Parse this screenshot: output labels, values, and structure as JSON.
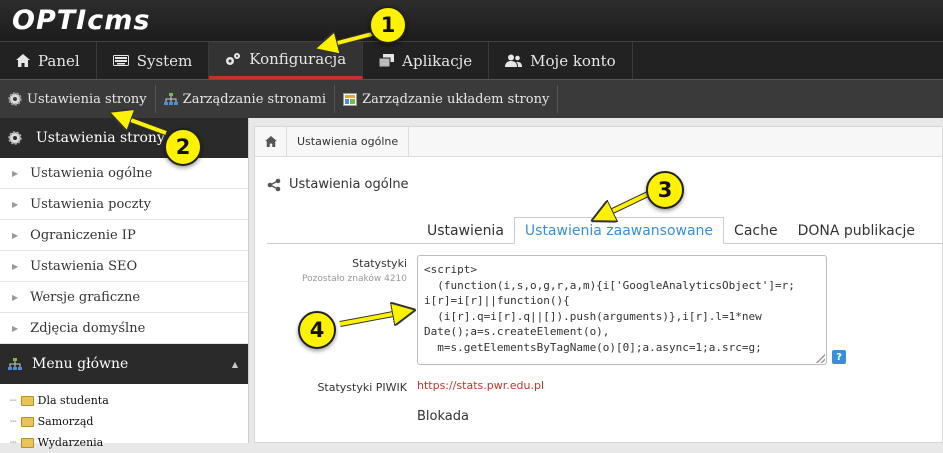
{
  "app": {
    "logo": "OPTIcms"
  },
  "mainnav": [
    {
      "label": "Panel",
      "icon": "home-icon"
    },
    {
      "label": "System",
      "icon": "keyboard-icon"
    },
    {
      "label": "Konfiguracja",
      "icon": "gears-icon"
    },
    {
      "label": "Aplikacje",
      "icon": "stack-icon"
    },
    {
      "label": "Moje konto",
      "icon": "users-icon"
    }
  ],
  "subnav": [
    {
      "label": "Ustawienia strony",
      "icon": "gear-icon"
    },
    {
      "label": "Zarządzanie stronami",
      "icon": "sitemap-icon"
    },
    {
      "label": "Zarządzanie układem strony",
      "icon": "layout-icon"
    }
  ],
  "sidebar": {
    "section1_title": "Ustawienia strony",
    "items": [
      "Ustawienia ogólne",
      "Ustawienia poczty",
      "Ograniczenie IP",
      "Ustawienia SEO",
      "Wersje graficzne",
      "Zdjęcia domyślne"
    ],
    "section2_title": "Menu główne",
    "tree": [
      "Dla studenta",
      "Samorząd",
      "Wydarzenia"
    ]
  },
  "content": {
    "breadcrumb": "Ustawienia ogólne",
    "panel_title": "Ustawienia ogólne",
    "tabs": [
      "Ustawienia",
      "Ustawienia zaawansowane",
      "Cache",
      "DONA publikacje"
    ],
    "stats_label": "Statystyki",
    "stats_hint": "Pozostało znaków 4210",
    "stats_code": "<script>\n  (function(i,s,o,g,r,a,m){i['GoogleAnalyticsObject']=r;\ni[r]=i[r]||function(){\n  (i[r].q=i[r].q||[]).push(arguments)},i[r].l=1*new\nDate();a=s.createElement(o),\n  m=s.getElementsByTagName(o)[0];a.async=1;a.src=g;",
    "help": "?",
    "piwik_label": "Statystyki PIWIK",
    "piwik_value": "https://stats.pwr.edu.pl",
    "blokada_label": "Blokada"
  },
  "badges": [
    "1",
    "2",
    "3",
    "4"
  ],
  "colors": {
    "accent": "#3a8ed8",
    "active_border": "#c9302c",
    "badge": "#fff200",
    "link": "#c0392b"
  }
}
